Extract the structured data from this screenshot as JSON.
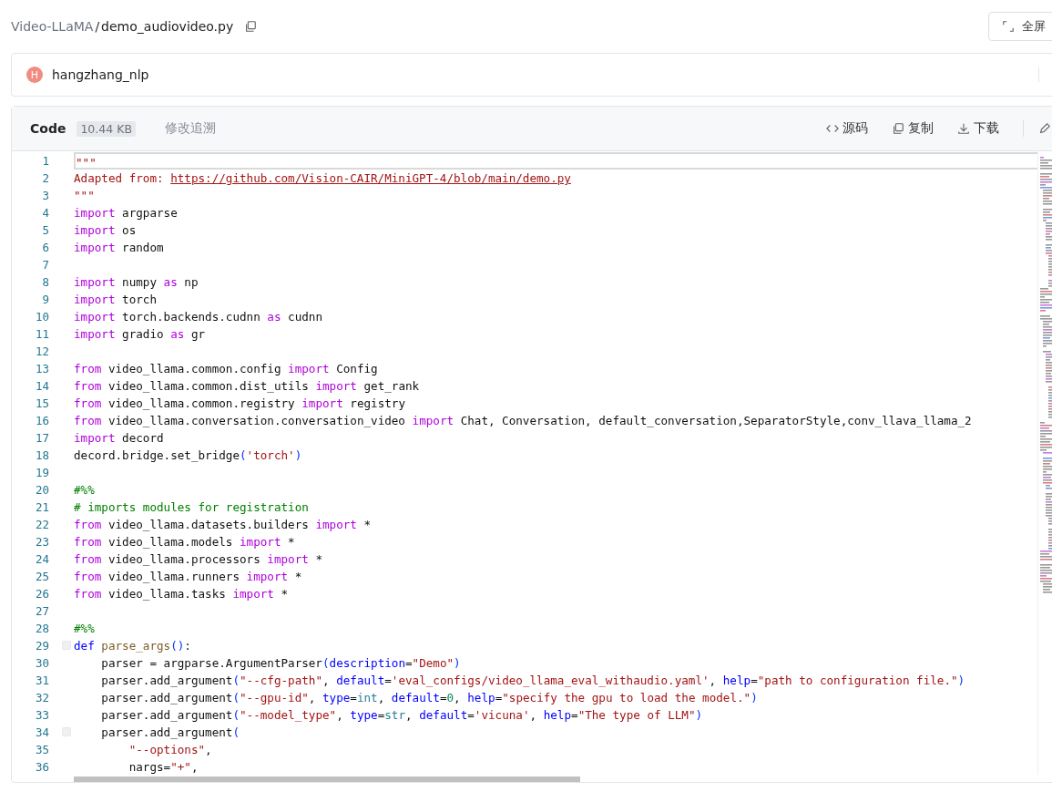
{
  "breadcrumb": {
    "repo": "Video-LLaMA",
    "separator": "/",
    "file": "demo_audiovideo.py"
  },
  "fullscreen_button": "全屏",
  "author": {
    "initial": "H",
    "name": "hangzhang_nlp",
    "color": "#f28b82"
  },
  "code_header": {
    "tabs": [
      {
        "label": "Code",
        "selected": true
      },
      {
        "label": "修改追溯",
        "selected": false
      }
    ],
    "size": "10.44 KB",
    "actions": [
      "源码",
      "复制",
      "下载"
    ]
  },
  "lines": [
    {
      "n": "1",
      "current": true,
      "fold": false,
      "tokens": [
        {
          "kind": "str",
          "t": "\"\"\""
        }
      ]
    },
    {
      "n": "2",
      "current": false,
      "fold": false,
      "tokens": [
        {
          "kind": "str",
          "t": "Adapted from: "
        },
        {
          "kind": "link",
          "t": "https://github.com/Vision-CAIR/MiniGPT-4/blob/main/demo.py"
        }
      ]
    },
    {
      "n": "3",
      "current": false,
      "fold": false,
      "tokens": [
        {
          "kind": "str",
          "t": "\"\"\""
        }
      ]
    },
    {
      "n": "4",
      "current": false,
      "fold": false,
      "tokens": [
        {
          "kind": "kw",
          "t": "import"
        },
        {
          "kind": "p",
          "t": " argparse"
        }
      ]
    },
    {
      "n": "5",
      "current": false,
      "fold": false,
      "tokens": [
        {
          "kind": "kw",
          "t": "import"
        },
        {
          "kind": "p",
          "t": " os"
        }
      ]
    },
    {
      "n": "6",
      "current": false,
      "fold": false,
      "tokens": [
        {
          "kind": "kw",
          "t": "import"
        },
        {
          "kind": "p",
          "t": " random"
        }
      ]
    },
    {
      "n": "7",
      "current": false,
      "fold": false
    },
    {
      "n": "8",
      "current": false,
      "fold": false,
      "tokens": [
        {
          "kind": "kw",
          "t": "import"
        },
        {
          "kind": "p",
          "t": " numpy "
        },
        {
          "kind": "kw",
          "t": "as"
        },
        {
          "kind": "p",
          "t": " np"
        }
      ]
    },
    {
      "n": "9",
      "current": false,
      "fold": false,
      "tokens": [
        {
          "kind": "kw",
          "t": "import"
        },
        {
          "kind": "p",
          "t": " torch"
        }
      ]
    },
    {
      "n": "10",
      "current": false,
      "fold": false,
      "tokens": [
        {
          "kind": "kw",
          "t": "import"
        },
        {
          "kind": "p",
          "t": " torch.backends.cudnn "
        },
        {
          "kind": "kw",
          "t": "as"
        },
        {
          "kind": "p",
          "t": " cudnn"
        }
      ]
    },
    {
      "n": "11",
      "current": false,
      "fold": false,
      "tokens": [
        {
          "kind": "kw",
          "t": "import"
        },
        {
          "kind": "p",
          "t": " gradio "
        },
        {
          "kind": "kw",
          "t": "as"
        },
        {
          "kind": "p",
          "t": " gr"
        }
      ]
    },
    {
      "n": "12",
      "current": false,
      "fold": false
    },
    {
      "n": "13",
      "current": false,
      "fold": false,
      "tokens": [
        {
          "kind": "kw",
          "t": "from"
        },
        {
          "kind": "p",
          "t": " video_llama.common.config "
        },
        {
          "kind": "kw",
          "t": "import"
        },
        {
          "kind": "p",
          "t": " Config"
        }
      ]
    },
    {
      "n": "14",
      "current": false,
      "fold": false,
      "tokens": [
        {
          "kind": "kw",
          "t": "from"
        },
        {
          "kind": "p",
          "t": " video_llama.common.dist_utils "
        },
        {
          "kind": "kw",
          "t": "import"
        },
        {
          "kind": "p",
          "t": " get_rank"
        }
      ]
    },
    {
      "n": "15",
      "current": false,
      "fold": false,
      "tokens": [
        {
          "kind": "kw",
          "t": "from"
        },
        {
          "kind": "p",
          "t": " video_llama.common.registry "
        },
        {
          "kind": "kw",
          "t": "import"
        },
        {
          "kind": "p",
          "t": " registry"
        }
      ]
    },
    {
      "n": "16",
      "current": false,
      "fold": false,
      "tokens": [
        {
          "kind": "kw",
          "t": "from"
        },
        {
          "kind": "p",
          "t": " video_llama.conversation.conversation_video "
        },
        {
          "kind": "kw",
          "t": "import"
        },
        {
          "kind": "p",
          "t": " Chat, Conversation, default_conversation,SeparatorStyle,conv_llava_llama_2"
        }
      ]
    },
    {
      "n": "17",
      "current": false,
      "fold": false,
      "tokens": [
        {
          "kind": "kw",
          "t": "import"
        },
        {
          "kind": "p",
          "t": " decord"
        }
      ]
    },
    {
      "n": "18",
      "current": false,
      "fold": false,
      "tokens": [
        {
          "kind": "p",
          "t": "decord.bridge.set_bridge"
        },
        {
          "kind": "par",
          "t": "("
        },
        {
          "kind": "str",
          "t": "'torch'"
        },
        {
          "kind": "par",
          "t": ")"
        }
      ]
    },
    {
      "n": "19",
      "current": false,
      "fold": false
    },
    {
      "n": "20",
      "current": false,
      "fold": false,
      "tokens": [
        {
          "kind": "com",
          "t": "#%%"
        }
      ]
    },
    {
      "n": "21",
      "current": false,
      "fold": false,
      "tokens": [
        {
          "kind": "com",
          "t": "# imports modules for registration"
        }
      ]
    },
    {
      "n": "22",
      "current": false,
      "fold": false,
      "tokens": [
        {
          "kind": "kw",
          "t": "from"
        },
        {
          "kind": "p",
          "t": " video_llama.datasets.builders "
        },
        {
          "kind": "kw",
          "t": "import"
        },
        {
          "kind": "p",
          "t": " *"
        }
      ]
    },
    {
      "n": "23",
      "current": false,
      "fold": false,
      "tokens": [
        {
          "kind": "kw",
          "t": "from"
        },
        {
          "kind": "p",
          "t": " video_llama.models "
        },
        {
          "kind": "kw",
          "t": "import"
        },
        {
          "kind": "p",
          "t": " *"
        }
      ]
    },
    {
      "n": "24",
      "current": false,
      "fold": false,
      "tokens": [
        {
          "kind": "kw",
          "t": "from"
        },
        {
          "kind": "p",
          "t": " video_llama.processors "
        },
        {
          "kind": "kw",
          "t": "import"
        },
        {
          "kind": "p",
          "t": " *"
        }
      ]
    },
    {
      "n": "25",
      "current": false,
      "fold": false,
      "tokens": [
        {
          "kind": "kw",
          "t": "from"
        },
        {
          "kind": "p",
          "t": " video_llama.runners "
        },
        {
          "kind": "kw",
          "t": "import"
        },
        {
          "kind": "p",
          "t": " *"
        }
      ]
    },
    {
      "n": "26",
      "current": false,
      "fold": false,
      "tokens": [
        {
          "kind": "kw",
          "t": "from"
        },
        {
          "kind": "p",
          "t": " video_llama.tasks "
        },
        {
          "kind": "kw",
          "t": "import"
        },
        {
          "kind": "p",
          "t": " *"
        }
      ]
    },
    {
      "n": "27",
      "current": false,
      "fold": false
    },
    {
      "n": "28",
      "current": false,
      "fold": false,
      "tokens": [
        {
          "kind": "com",
          "t": "#%%"
        }
      ]
    },
    {
      "n": "29",
      "current": false,
      "fold": true,
      "tokens": [
        {
          "kind": "kw2",
          "t": "def"
        },
        {
          "kind": "fn",
          "t": " parse_args"
        },
        {
          "kind": "par",
          "t": "()"
        },
        {
          "kind": "p",
          "t": ":"
        }
      ]
    },
    {
      "n": "30",
      "current": false,
      "fold": false,
      "tokens": [
        {
          "kind": "p",
          "t": "    parser = argparse.ArgumentParser"
        },
        {
          "kind": "par",
          "t": "("
        },
        {
          "kind": "kw2",
          "t": "description"
        },
        {
          "kind": "p",
          "t": "="
        },
        {
          "kind": "str",
          "t": "\"Demo\""
        },
        {
          "kind": "par",
          "t": ")"
        }
      ]
    },
    {
      "n": "31",
      "current": false,
      "fold": false,
      "tokens": [
        {
          "kind": "p",
          "t": "    parser.add_argument"
        },
        {
          "kind": "par",
          "t": "("
        },
        {
          "kind": "str",
          "t": "\"--cfg-path\""
        },
        {
          "kind": "p",
          "t": ", "
        },
        {
          "kind": "kw2",
          "t": "default"
        },
        {
          "kind": "p",
          "t": "="
        },
        {
          "kind": "str",
          "t": "'eval_configs/video_llama_eval_withaudio.yaml'"
        },
        {
          "kind": "p",
          "t": ", "
        },
        {
          "kind": "kw2",
          "t": "help"
        },
        {
          "kind": "p",
          "t": "="
        },
        {
          "kind": "str",
          "t": "\"path to configuration file.\""
        },
        {
          "kind": "par",
          "t": ")"
        }
      ]
    },
    {
      "n": "32",
      "current": false,
      "fold": false,
      "tokens": [
        {
          "kind": "p",
          "t": "    parser.add_argument"
        },
        {
          "kind": "par",
          "t": "("
        },
        {
          "kind": "str",
          "t": "\"--gpu-id\""
        },
        {
          "kind": "p",
          "t": ", "
        },
        {
          "kind": "kw2",
          "t": "type"
        },
        {
          "kind": "p",
          "t": "="
        },
        {
          "kind": "bi",
          "t": "int"
        },
        {
          "kind": "p",
          "t": ", "
        },
        {
          "kind": "kw2",
          "t": "default"
        },
        {
          "kind": "p",
          "t": "="
        },
        {
          "kind": "num",
          "t": "0"
        },
        {
          "kind": "p",
          "t": ", "
        },
        {
          "kind": "kw2",
          "t": "help"
        },
        {
          "kind": "p",
          "t": "="
        },
        {
          "kind": "str",
          "t": "\"specify the gpu to load the model.\""
        },
        {
          "kind": "par",
          "t": ")"
        }
      ]
    },
    {
      "n": "33",
      "current": false,
      "fold": false,
      "tokens": [
        {
          "kind": "p",
          "t": "    parser.add_argument"
        },
        {
          "kind": "par",
          "t": "("
        },
        {
          "kind": "str",
          "t": "\"--model_type\""
        },
        {
          "kind": "p",
          "t": ", "
        },
        {
          "kind": "kw2",
          "t": "type"
        },
        {
          "kind": "p",
          "t": "="
        },
        {
          "kind": "bi",
          "t": "str"
        },
        {
          "kind": "p",
          "t": ", "
        },
        {
          "kind": "kw2",
          "t": "default"
        },
        {
          "kind": "p",
          "t": "="
        },
        {
          "kind": "str",
          "t": "'vicuna'"
        },
        {
          "kind": "p",
          "t": ", "
        },
        {
          "kind": "kw2",
          "t": "help"
        },
        {
          "kind": "p",
          "t": "="
        },
        {
          "kind": "str",
          "t": "\"The type of LLM\""
        },
        {
          "kind": "par",
          "t": ")"
        }
      ]
    },
    {
      "n": "34",
      "current": false,
      "fold": true,
      "tokens": [
        {
          "kind": "p",
          "t": "    parser.add_argument"
        },
        {
          "kind": "par",
          "t": "("
        }
      ]
    },
    {
      "n": "35",
      "current": false,
      "fold": false,
      "tokens": [
        {
          "kind": "str",
          "t": "        \"--options\""
        },
        {
          "kind": "p",
          "t": ","
        }
      ]
    },
    {
      "n": "36",
      "current": false,
      "fold": false,
      "tokens": [
        {
          "kind": "p",
          "t": "        nargs="
        },
        {
          "kind": "str",
          "t": "\"+\""
        },
        {
          "kind": "p",
          "t": ","
        }
      ]
    }
  ]
}
